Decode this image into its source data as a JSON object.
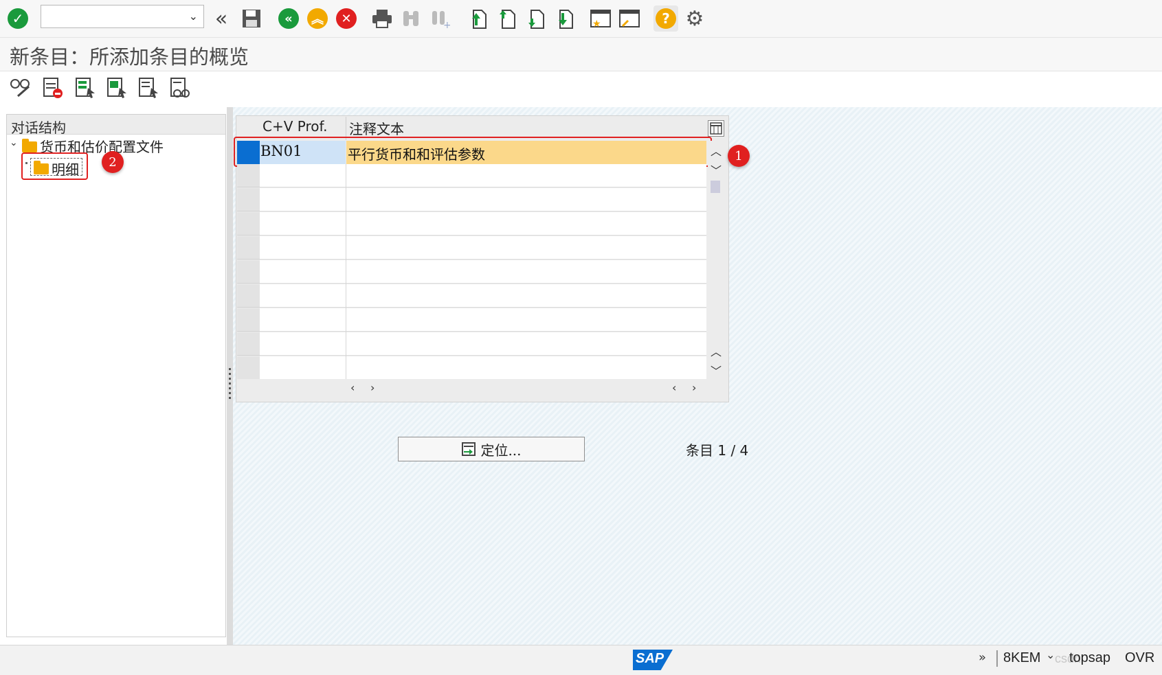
{
  "window": {
    "title": "新条目：所添加条目的概览"
  },
  "toolbar": {
    "command_field_value": "",
    "icons": [
      "enter-check-icon",
      "back-icon",
      "save-icon",
      "back-green-icon",
      "exit-icon",
      "cancel-icon",
      "print-icon",
      "find-icon",
      "find-next-icon",
      "first-page-icon",
      "prev-page-icon",
      "next-page-icon",
      "last-page-icon",
      "create-session-icon",
      "shortcut-icon",
      "help-icon",
      "customize-icon"
    ]
  },
  "app_toolbar": {
    "icons": [
      "display-change-icon",
      "delete-icon",
      "select-all-icon",
      "select-block-icon",
      "deselect-all-icon",
      "print-view-icon"
    ]
  },
  "dialog_structure": {
    "title": "对话结构",
    "root": "货币和估价配置文件",
    "child": "明细"
  },
  "table": {
    "columns": [
      "C+V Prof.",
      "注释文本"
    ],
    "rows": [
      {
        "code": "BN01",
        "text": "平行货币和和评估参数"
      }
    ],
    "empty_rows": 9
  },
  "annotations": {
    "badge1": "1",
    "badge2": "2"
  },
  "locate_button": {
    "label": "定位..."
  },
  "entry_info": {
    "label": "条目",
    "value": "1 / 4"
  },
  "status": {
    "sap_logo": "SAP",
    "system": "8KEM",
    "server": "topsap",
    "mode": "OVR",
    "watermark": "csdn"
  },
  "colors": {
    "accent_green": "#1a9a3c",
    "orange": "#f2a900",
    "red": "#e02020",
    "sel_blue": "#0a6ed1",
    "sel_yellow": "#fbd88a"
  }
}
